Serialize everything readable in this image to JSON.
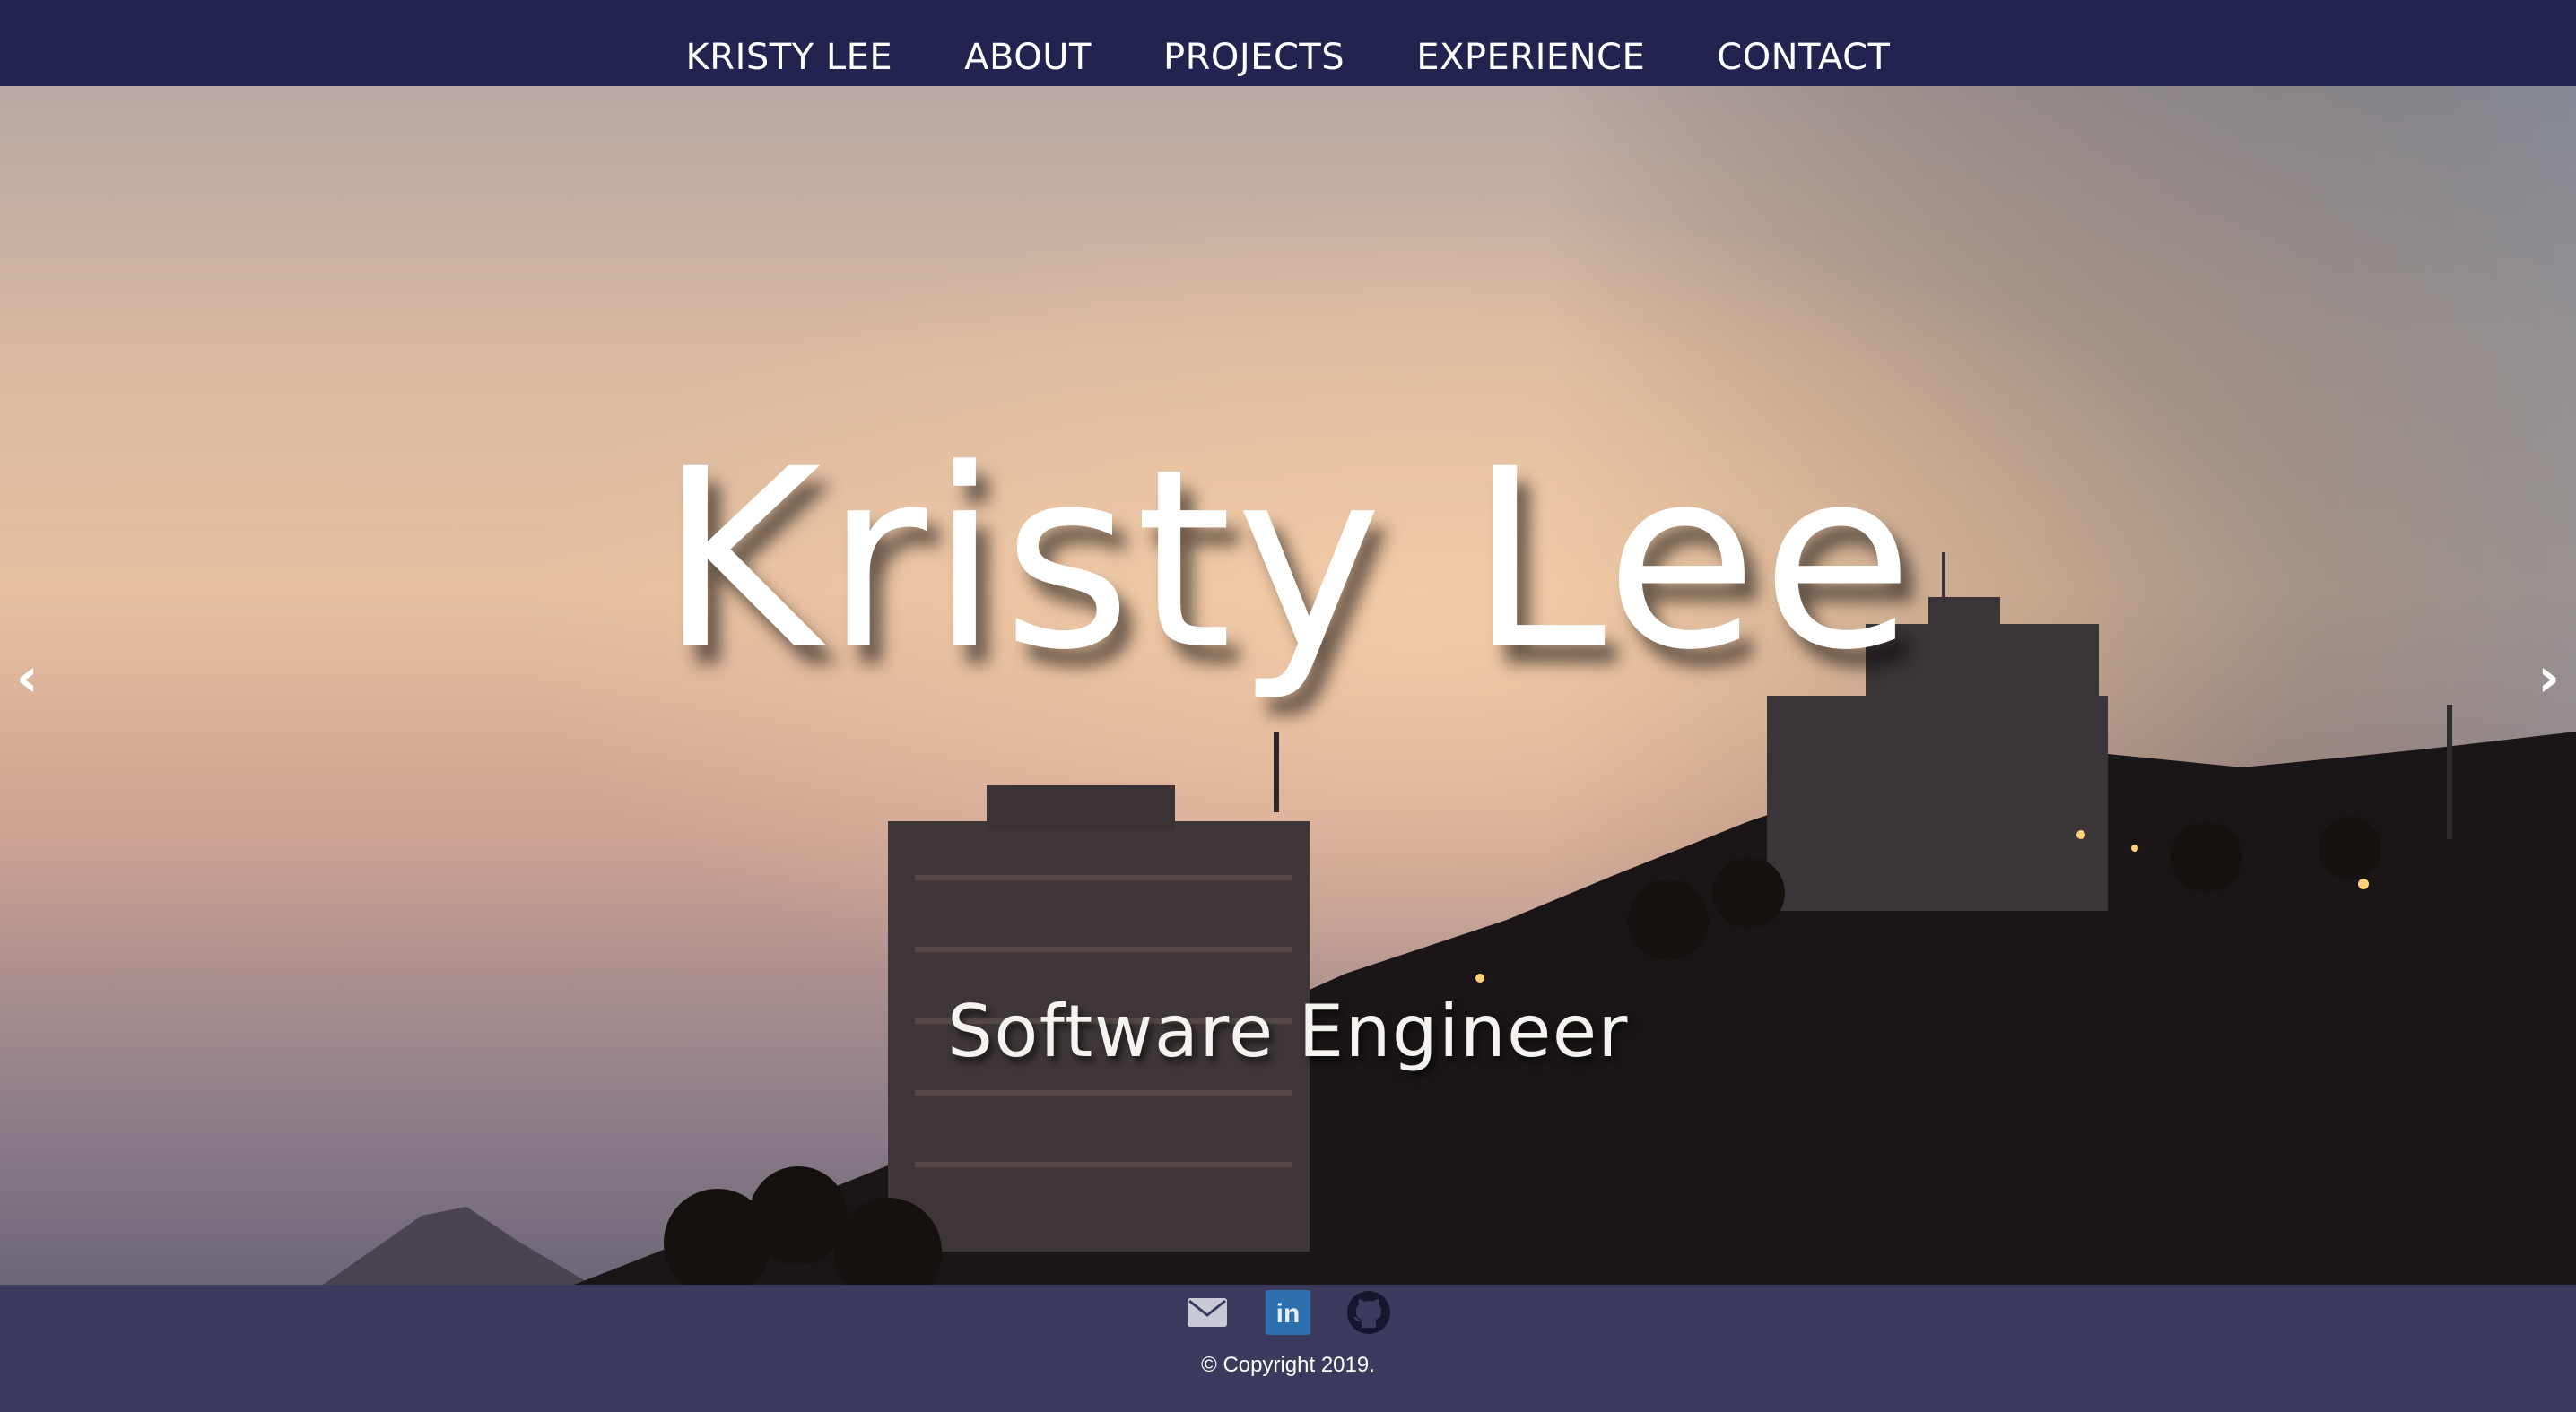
{
  "nav": {
    "items": [
      {
        "label": "KRISTY LEE"
      },
      {
        "label": "ABOUT"
      },
      {
        "label": "PROJECTS"
      },
      {
        "label": "EXPERIENCE"
      },
      {
        "label": "CONTACT"
      }
    ]
  },
  "hero": {
    "title": "Kristy Lee",
    "subtitle": "Software Engineer",
    "prev_arrow": "‹",
    "next_arrow": "›"
  },
  "footer": {
    "social": [
      {
        "icon": "mail-icon"
      },
      {
        "icon": "linkedin-icon"
      },
      {
        "icon": "github-icon"
      }
    ],
    "linkedin_glyph": "in",
    "copyright": "© Copyright 2019."
  },
  "colors": {
    "nav_bg": "#22244f",
    "footer_bg": "#3b3b5e",
    "linkedin_blue": "#2c6fad",
    "text": "#ffffff"
  }
}
